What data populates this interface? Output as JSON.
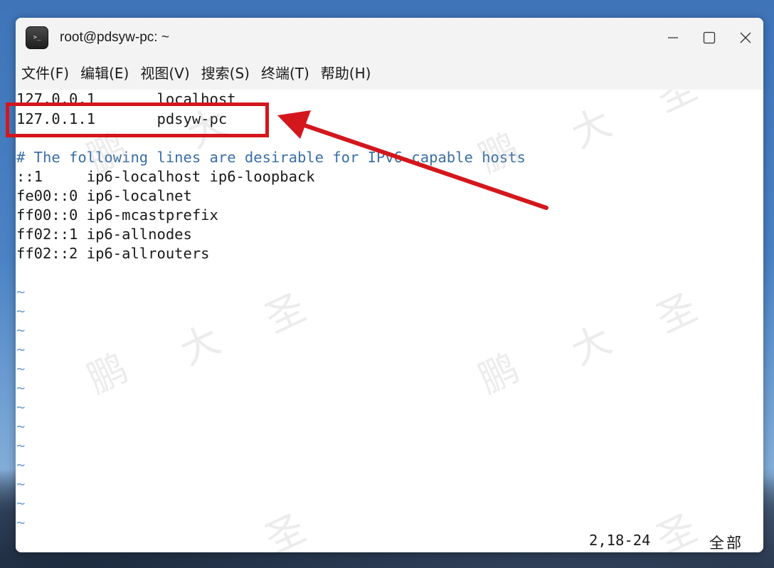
{
  "window": {
    "title": "root@pdsyw-pc: ~",
    "app_icon_glyph": ">_"
  },
  "menu": [
    {
      "label": "文件(F)"
    },
    {
      "label": "编辑(E)"
    },
    {
      "label": "视图(V)"
    },
    {
      "label": "搜索(S)"
    },
    {
      "label": "终端(T)"
    },
    {
      "label": "帮助(H)"
    }
  ],
  "terminal": {
    "lines": [
      "127.0.0.1       localhost",
      "127.0.1.1       pdsyw-pc",
      "",
      "# The following lines are desirable for IPv6 capable hosts",
      "::1     ip6-localhost ip6-loopback",
      "fe00::0 ip6-localnet",
      "ff00::0 ip6-mcastprefix",
      "ff02::1 ip6-allnodes",
      "ff02::2 ip6-allrouters"
    ],
    "tilde": "~",
    "status_position": "2,18-24",
    "status_range": "全部"
  },
  "watermark": [
    "鹏",
    "大",
    "圣"
  ],
  "colors": {
    "comment": "#3a6ea8",
    "tilde": "#6f9fd4",
    "highlight": "#d3171d"
  }
}
